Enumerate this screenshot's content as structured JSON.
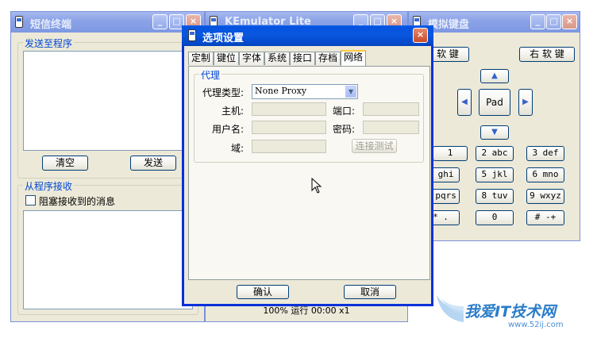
{
  "sms_window": {
    "title": "短信终端",
    "send_group_label": "发送至程序",
    "clear_button": "清空",
    "send_button": "发送",
    "receive_group_label": "从程序接收",
    "block_checkbox_label": "阻塞接收到的消息",
    "block_checked": false
  },
  "emulator_window": {
    "title": "KEmulator Lite",
    "status": "100% 运行 00:00 x1"
  },
  "keyboard_window": {
    "title": "模拟键盘",
    "left_soft_key": "左 软 键",
    "right_soft_key": "右 软 键",
    "pad_label": "Pad",
    "keys": [
      "1",
      "2 abc",
      "3 def",
      "4 ghi",
      "5 jkl",
      "6 mno",
      "7 pqrs",
      "8 tuv",
      "9 wxyz",
      "* .",
      "0",
      "# -+"
    ]
  },
  "options_dialog": {
    "title": "选项设置",
    "tabs": [
      "定制",
      "键位",
      "字体",
      "系统",
      "接口",
      "存档",
      "网络"
    ],
    "selected_tab": "网络",
    "proxy_group_label": "代理",
    "proxy_type_label": "代理类型:",
    "proxy_type_value": "None Proxy",
    "host_label": "主机:",
    "host_value": "",
    "port_label": "端口:",
    "port_value": "",
    "username_label": "用户名:",
    "username_value": "",
    "password_label": "密码:",
    "password_value": "",
    "domain_label": "域:",
    "domain_value": "",
    "test_connection_button": "连接测试",
    "ok_button": "确认",
    "cancel_button": "取消"
  },
  "watermark": {
    "site_name": "我爱IT技术网",
    "url": "www.52ij.com"
  },
  "colors": {
    "active_title": "#0a56df",
    "inactive_title": "#8aa2e6",
    "window_face": "#ece9d8",
    "group_label": "#0046d5",
    "watermark": "#2a7cc8"
  }
}
